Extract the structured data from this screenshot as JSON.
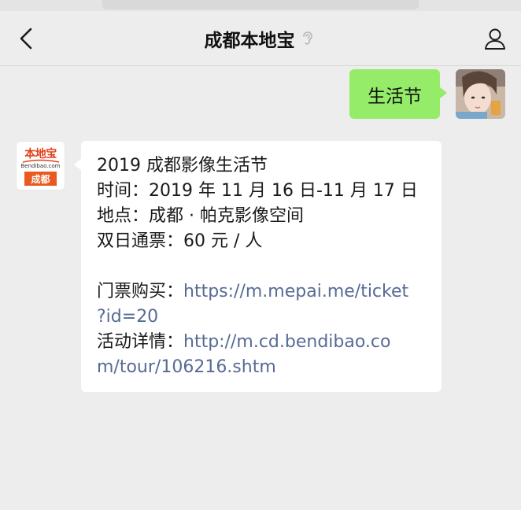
{
  "header": {
    "title": "成都本地宝",
    "back_icon": "chevron-left-icon",
    "status_icon": "ear-icon",
    "profile_icon": "person-icon"
  },
  "messages": {
    "user": {
      "text": "生活节",
      "bubble_color": "#95ec69"
    },
    "bot": {
      "avatar": {
        "brand": "本地宝",
        "url": "Bendibao.com",
        "city": "成都",
        "brand_color": "#e3411e",
        "city_color": "#e85a1f"
      },
      "lines": {
        "l1": "2019 成都影像生活节",
        "l2": "时间：2019 年 11 月 16 日-11 月 17 日",
        "l3": "地点：成都 · 帕克影像空间",
        "l4": "双日通票：60 元 / 人",
        "ticket_label": "门票购买：",
        "ticket_link_a": "https://m.mepai.me/ticket",
        "ticket_link_b": "?id=20",
        "detail_label": "活动详情：",
        "detail_link_a": "http://m.cd.bendibao.co",
        "detail_link_b": "m/tour/106216.shtm"
      },
      "link_color": "#576b95"
    }
  }
}
